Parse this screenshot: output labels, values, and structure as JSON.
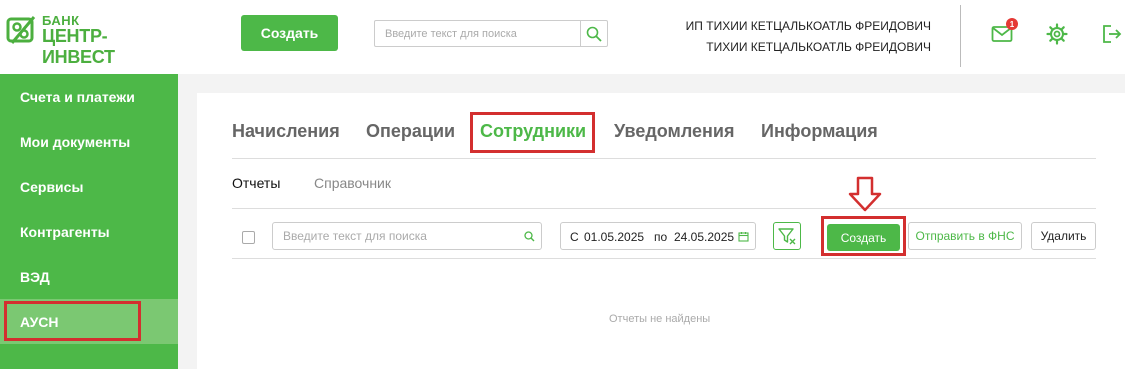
{
  "brand": {
    "line1": "БАНК",
    "line2": "ЦЕНТР-ИНВЕСТ",
    "accent": "#4db848"
  },
  "header": {
    "create_label": "Создать",
    "search_placeholder": "Введите текст для поиска",
    "company": "ИП ТИХИИ КЕТЦАЛЬКОАТЛЬ ФРЕИДОВИЧ",
    "user": "ТИХИИ КЕТЦАЛЬКОАТЛЬ ФРЕИДОВИЧ",
    "mail_badge": "1",
    "icons": [
      "mail-icon",
      "gear-icon",
      "logout-icon"
    ]
  },
  "sidebar": {
    "items": [
      {
        "label": "Счета и платежи"
      },
      {
        "label": "Мои документы"
      },
      {
        "label": "Сервисы"
      },
      {
        "label": "Контрагенты"
      },
      {
        "label": "ВЭД"
      },
      {
        "label": "АУСН"
      }
    ],
    "active": "АУСН"
  },
  "tabs": [
    {
      "label": "Начисления"
    },
    {
      "label": "Операции"
    },
    {
      "label": "Сотрудники"
    },
    {
      "label": "Уведомления"
    },
    {
      "label": "Информация"
    }
  ],
  "active_tab": "Сотрудники",
  "subtabs": [
    {
      "label": "Отчеты"
    },
    {
      "label": "Справочник"
    }
  ],
  "active_subtab": "Отчеты",
  "toolbar": {
    "search_placeholder": "Введите текст для поиска",
    "date_from_prefix": "С",
    "date_from": "01.05.2025",
    "date_to_prefix": "по",
    "date_to": "24.05.2025",
    "create_label": "Создать",
    "send_label": "Отправить в ФНС",
    "delete_label": "Удалить"
  },
  "empty_message": "Отчеты не найдены",
  "highlight_color": "#d32f2f"
}
